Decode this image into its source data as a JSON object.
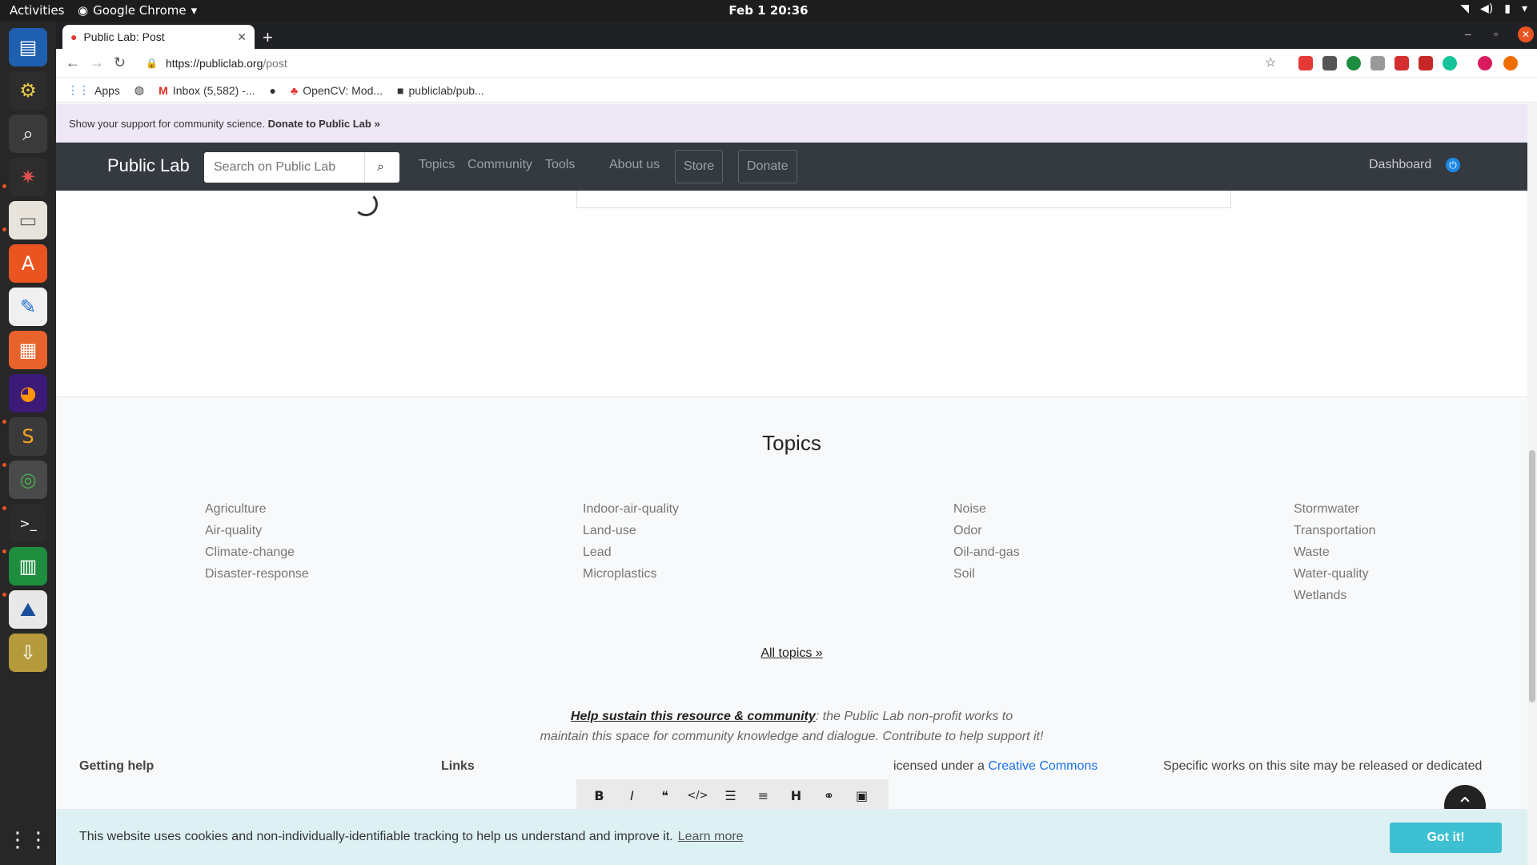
{
  "os": {
    "activities": "Activities",
    "app_name": "Google Chrome",
    "clock": "Feb 1  20:36"
  },
  "browser": {
    "tab_title": "Public Lab: Post",
    "url_scheme_host": "https://publiclab.org",
    "url_path": "/post",
    "bookmarks": [
      "Apps",
      "Inbox (5,582) -...",
      "OpenCV: Mod...",
      "publiclab/pub..."
    ]
  },
  "page": {
    "support_text": "Show your support for community science.",
    "support_link": "Donate to Public Lab »",
    "brand": "Public Lab",
    "search_placeholder": "Search on Public Lab",
    "nav": {
      "topics": "Topics",
      "community": "Community",
      "tools": "Tools",
      "about": "About us",
      "store": "Store",
      "donate": "Donate",
      "dashboard": "Dashboard"
    },
    "topics_title": "Topics",
    "topic_columns": [
      [
        "Agriculture",
        "Air-quality",
        "Climate-change",
        "Disaster-response"
      ],
      [
        "Indoor-air-quality",
        "Land-use",
        "Lead",
        "Microplastics"
      ],
      [
        "Noise",
        "Odor",
        "Oil-and-gas",
        "Soil"
      ],
      [
        "Stormwater",
        "Transportation",
        "Waste",
        "Water-quality",
        "Wetlands"
      ]
    ],
    "all_topics": "All topics »",
    "sustain_link": "Help sustain this resource & community",
    "sustain_line1": ": the Public Lab non-profit works to",
    "sustain_line2": "maintain this space for community knowledge and dialogue. Contribute to help support it!",
    "footer": {
      "getting_help": "Getting help",
      "links": "Links",
      "license_text": "icensed under a",
      "license_link": "Creative Commons",
      "specific_works": "Specific works on this site may be released or dedicated"
    },
    "cookie_text": "This website uses cookies and non-individually-identifiable tracking to help us understand and improve it.",
    "cookie_learn": "Learn more",
    "cookie_btn": "Got it!"
  }
}
